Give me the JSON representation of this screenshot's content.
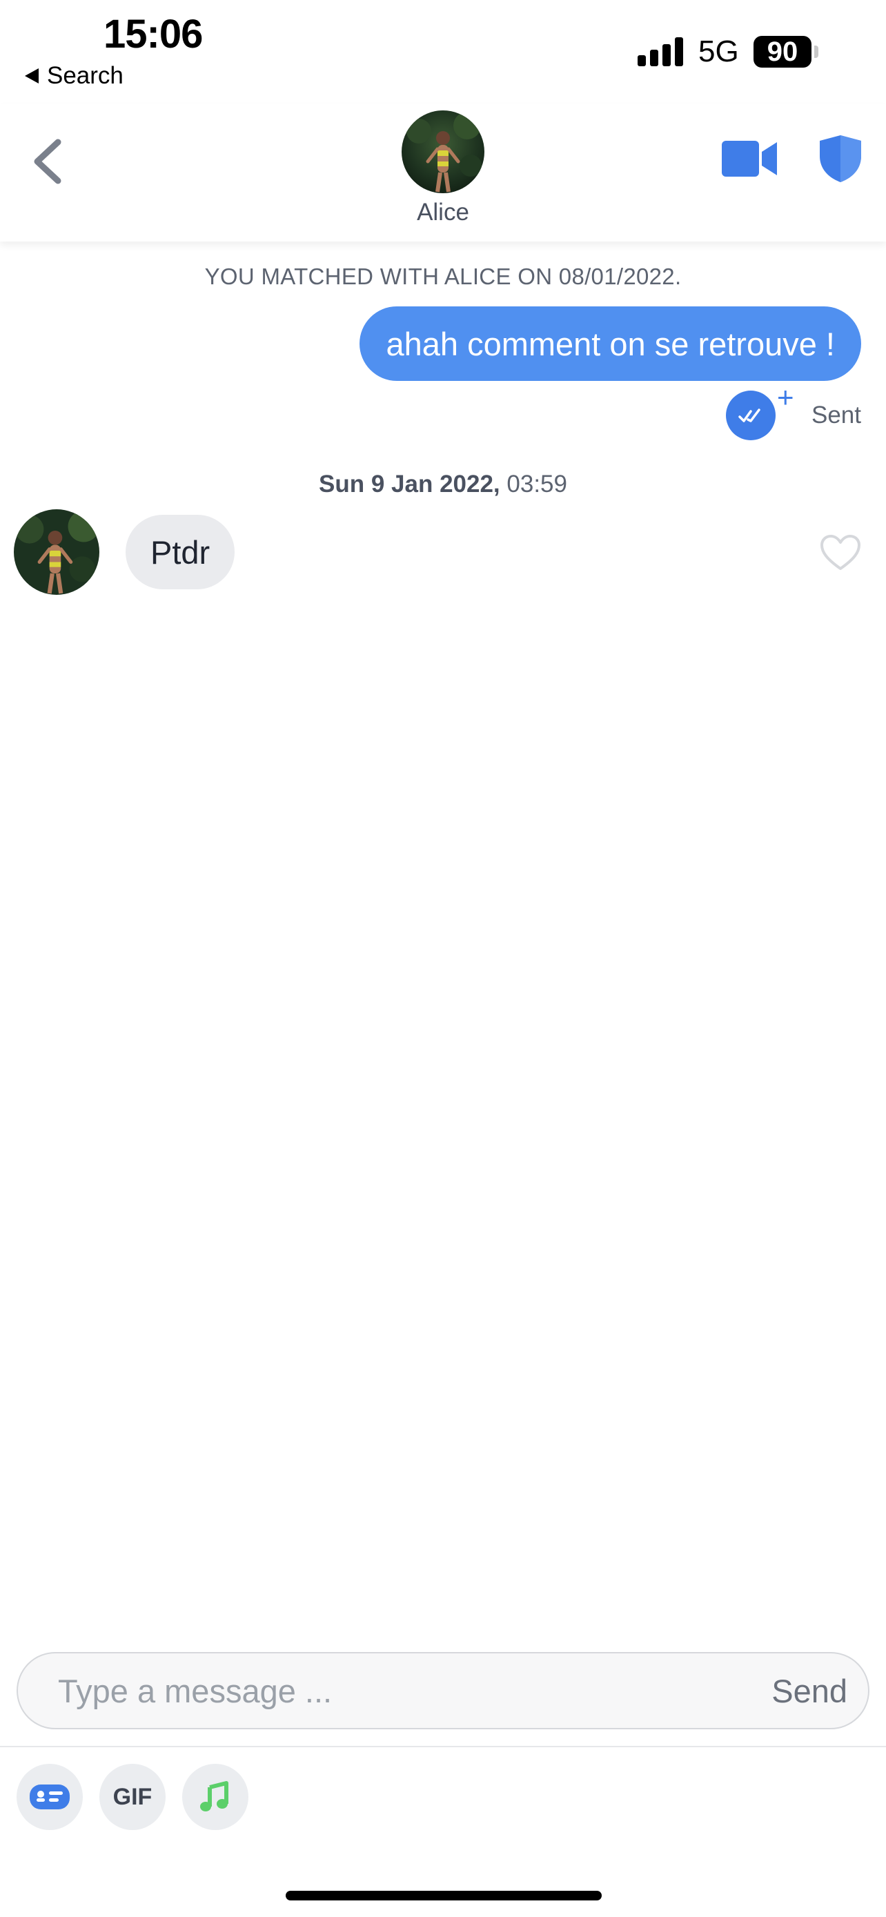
{
  "status_bar": {
    "time": "15:06",
    "back_label": "Search",
    "network": "5G",
    "battery": "90"
  },
  "header": {
    "name": "Alice",
    "back_icon": "chevron-left-icon",
    "video_icon": "video-camera-icon",
    "safety_icon": "shield-icon"
  },
  "messages": {
    "match_notice": "YOU MATCHED WITH ALICE ON 08/01/2022.",
    "sent": {
      "text": "ahah comment on se retrouve !",
      "status": "Sent"
    },
    "timestamp": {
      "date": "Sun 9 Jan 2022,",
      "time": "03:59"
    },
    "received": {
      "text": "Ptdr"
    }
  },
  "composer": {
    "placeholder": "Type a message ...",
    "send_label": "Send"
  },
  "tools": {
    "gif_label": "GIF"
  },
  "colors": {
    "accent": "#5090f0",
    "accent_dark": "#3f7de8",
    "received_bubble": "#eaebee",
    "music_green": "#5ccf6a"
  }
}
